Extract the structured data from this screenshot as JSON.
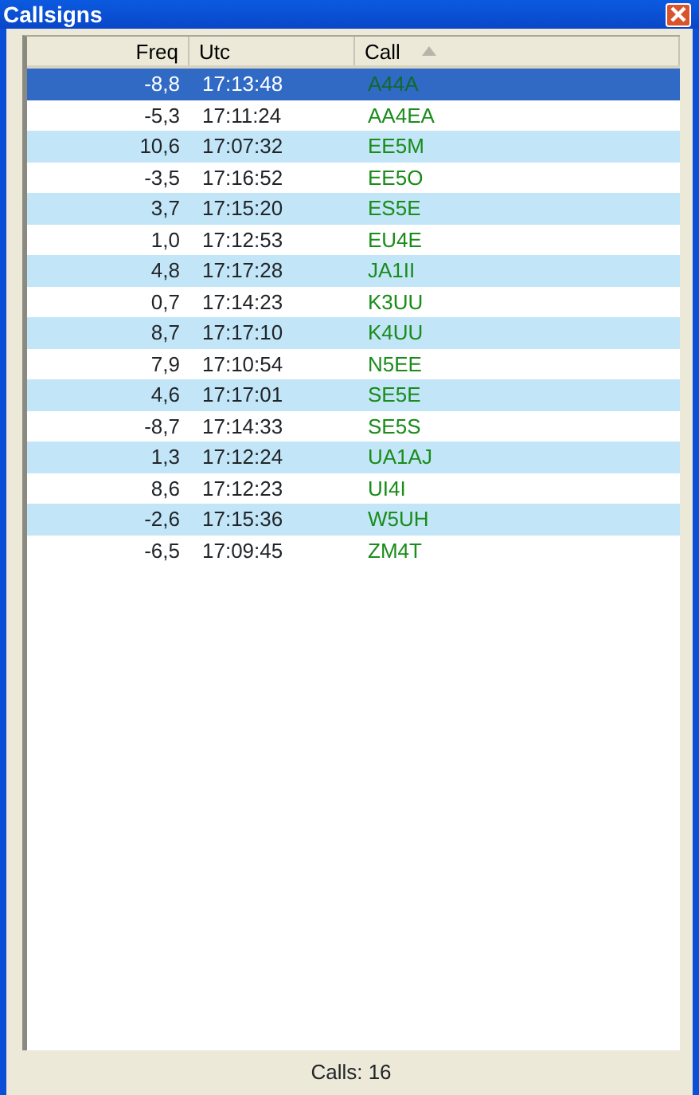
{
  "window": {
    "title": "Callsigns"
  },
  "columns": [
    {
      "label": "Freq",
      "sorted": false
    },
    {
      "label": "Utc",
      "sorted": false
    },
    {
      "label": "Call",
      "sorted": true
    }
  ],
  "rows": [
    {
      "freq": "-8,8",
      "utc": "17:13:48",
      "call": "A44A",
      "selected": true
    },
    {
      "freq": "-5,3",
      "utc": "17:11:24",
      "call": "AA4EA",
      "selected": false
    },
    {
      "freq": "10,6",
      "utc": "17:07:32",
      "call": "EE5M",
      "selected": false
    },
    {
      "freq": "-3,5",
      "utc": "17:16:52",
      "call": "EE5O",
      "selected": false
    },
    {
      "freq": "3,7",
      "utc": "17:15:20",
      "call": "ES5E",
      "selected": false
    },
    {
      "freq": "1,0",
      "utc": "17:12:53",
      "call": "EU4E",
      "selected": false
    },
    {
      "freq": "4,8",
      "utc": "17:17:28",
      "call": "JA1II",
      "selected": false
    },
    {
      "freq": "0,7",
      "utc": "17:14:23",
      "call": "K3UU",
      "selected": false
    },
    {
      "freq": "8,7",
      "utc": "17:17:10",
      "call": "K4UU",
      "selected": false
    },
    {
      "freq": "7,9",
      "utc": "17:10:54",
      "call": "N5EE",
      "selected": false
    },
    {
      "freq": "4,6",
      "utc": "17:17:01",
      "call": "SE5E",
      "selected": false
    },
    {
      "freq": "-8,7",
      "utc": "17:14:33",
      "call": "SE5S",
      "selected": false
    },
    {
      "freq": "1,3",
      "utc": "17:12:24",
      "call": "UA1AJ",
      "selected": false
    },
    {
      "freq": "8,6",
      "utc": "17:12:23",
      "call": "UI4I",
      "selected": false
    },
    {
      "freq": "-2,6",
      "utc": "17:15:36",
      "call": "W5UH",
      "selected": false
    },
    {
      "freq": "-6,5",
      "utc": "17:09:45",
      "call": "ZM4T",
      "selected": false
    }
  ],
  "status_bar": "Calls: 16"
}
